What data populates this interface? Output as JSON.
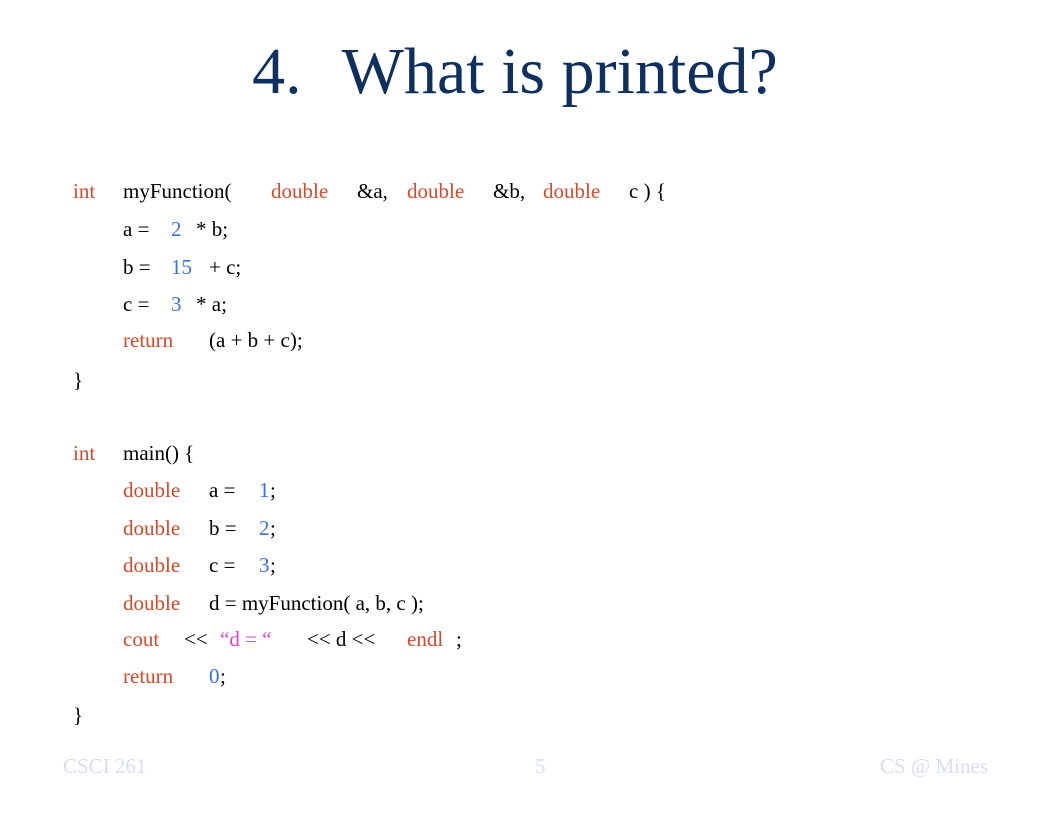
{
  "slide": {
    "title_number": "4.",
    "title_text": "What is printed?",
    "code": {
      "func_sig": {
        "ret_type": "int",
        "name": "myFunction(",
        "p1_type": "double",
        "p1_name": "&a,",
        "p2_type": "double",
        "p2_name": "&b,",
        "p3_type": "double",
        "p3_name": "c ) {"
      },
      "f_line1": {
        "lhs": "a =",
        "num": "2",
        "rest": "* b;"
      },
      "f_line2": {
        "lhs": "b =",
        "num": "15",
        "rest": "+ c;"
      },
      "f_line3": {
        "lhs": "c =",
        "num": "3",
        "rest": "* a;"
      },
      "f_return": {
        "kw": "return",
        "expr": "(a + b + c);"
      },
      "f_close": "}",
      "main_sig": {
        "ret_type": "int",
        "name": "main() {"
      },
      "m_line1": {
        "type": "double",
        "lhs": "a =",
        "num": "1",
        "semi": ";"
      },
      "m_line2": {
        "type": "double",
        "lhs": "b =",
        "num": "2",
        "semi": ";"
      },
      "m_line3": {
        "type": "double",
        "lhs": "c =",
        "num": "3",
        "semi": ";"
      },
      "m_line4": {
        "type": "double",
        "rest": "d = myFunction( a, b, c );"
      },
      "m_cout": {
        "kw": "cout",
        "op1": "<<",
        "str": "“d = “",
        "mid": "<< d <<",
        "endl": "endl",
        "semi": ";"
      },
      "m_return": {
        "kw": "return",
        "num": "0",
        "semi": ";"
      },
      "m_close": "}"
    },
    "footer": {
      "left": "CSCI 261",
      "center": "5",
      "right": "CS @ Mines"
    }
  },
  "colors": {
    "title": "#0f2f5f",
    "keyword": "#d04a2c",
    "number": "#3b6fe0",
    "string": "#e63ccf",
    "footer": "#d8dcf5"
  }
}
